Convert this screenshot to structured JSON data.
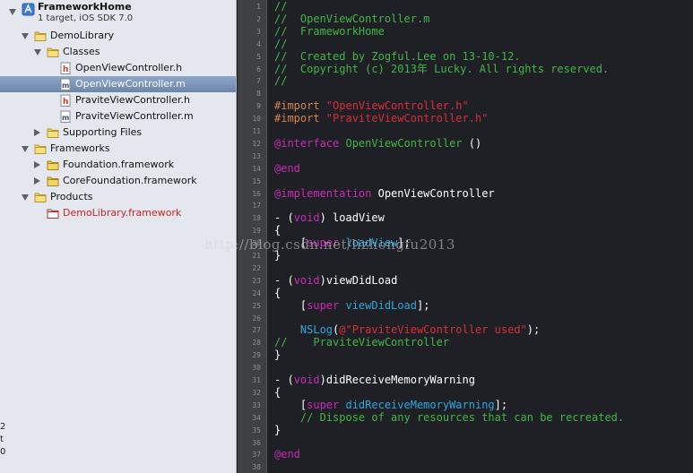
{
  "navigator": {
    "project_title": "FrameworkHome",
    "project_subtitle": "1 target, iOS SDK 7.0",
    "items": [
      {
        "label": "DemoLibrary",
        "icon": "folder-icon",
        "indent": 1,
        "disclosure": "open"
      },
      {
        "label": "Classes",
        "icon": "folder-icon",
        "indent": 2,
        "disclosure": "open"
      },
      {
        "label": "OpenViewController.h",
        "icon": "header-file-icon",
        "indent": 3,
        "disclosure": "none"
      },
      {
        "label": "OpenViewController.m",
        "icon": "implementation-file-icon",
        "indent": 3,
        "disclosure": "none",
        "selected": true
      },
      {
        "label": "PraviteViewController.h",
        "icon": "header-file-icon",
        "indent": 3,
        "disclosure": "none"
      },
      {
        "label": "PraviteViewController.m",
        "icon": "implementation-file-icon",
        "indent": 3,
        "disclosure": "none"
      },
      {
        "label": "Supporting Files",
        "icon": "folder-icon",
        "indent": 2,
        "disclosure": "closed"
      },
      {
        "label": "Frameworks",
        "icon": "folder-icon",
        "indent": 1,
        "disclosure": "open"
      },
      {
        "label": "Foundation.framework",
        "icon": "framework-icon",
        "indent": 2,
        "disclosure": "closed"
      },
      {
        "label": "CoreFoundation.framework",
        "icon": "framework-icon",
        "indent": 2,
        "disclosure": "closed"
      },
      {
        "label": "Products",
        "icon": "folder-icon",
        "indent": 1,
        "disclosure": "open"
      },
      {
        "label": "DemoLibrary.framework",
        "icon": "product-icon",
        "indent": 2,
        "disclosure": "none",
        "missing": true
      }
    ],
    "bottom_fragment": "2 t 0"
  },
  "colors": {
    "comment": "#41b645",
    "keyword": "#c72cb3",
    "string": "#db2c38",
    "preprocessor": "#d6824f",
    "class": "#78c2b3",
    "method": "#2ea6da",
    "plain": "#ffffff",
    "selection": "#6c86ad"
  },
  "editor": {
    "line_numbers": [
      "1",
      "2",
      "3",
      "4",
      "5",
      "6",
      "7",
      "8",
      "9",
      "10",
      "11",
      "12",
      "13",
      "14",
      "15",
      "16",
      "17",
      "18",
      "19",
      "20",
      "21",
      "22",
      "23",
      "24",
      "25",
      "26",
      "27",
      "28",
      "29",
      "30",
      "31",
      "32",
      "33",
      "34",
      "35",
      "36",
      "37",
      "38"
    ],
    "lines": [
      [
        {
          "t": "//",
          "c": "comment"
        }
      ],
      [
        {
          "t": "//  OpenViewController.m",
          "c": "comment"
        }
      ],
      [
        {
          "t": "//  FrameworkHome",
          "c": "comment"
        }
      ],
      [
        {
          "t": "//",
          "c": "comment"
        }
      ],
      [
        {
          "t": "//  Created by Zogful.Lee on 13-10-12.",
          "c": "comment"
        }
      ],
      [
        {
          "t": "//  Copyright (c) 2013年 Lucky. All rights reserved.",
          "c": "comment"
        }
      ],
      [
        {
          "t": "//",
          "c": "comment"
        }
      ],
      [],
      [
        {
          "t": "#import ",
          "c": "preprocessor"
        },
        {
          "t": "\"OpenViewController.h\"",
          "c": "string"
        }
      ],
      [
        {
          "t": "#import ",
          "c": "preprocessor"
        },
        {
          "t": "\"PraviteViewController.h\"",
          "c": "string"
        }
      ],
      [],
      [
        {
          "t": "@interface",
          "c": "keyword"
        },
        {
          "t": " ",
          "c": "plain"
        },
        {
          "t": "OpenViewController",
          "c": "comment"
        },
        {
          "t": " ()",
          "c": "plain"
        }
      ],
      [],
      [
        {
          "t": "@end",
          "c": "keyword"
        }
      ],
      [],
      [
        {
          "t": "@implementation",
          "c": "keyword"
        },
        {
          "t": " OpenViewController",
          "c": "plain"
        }
      ],
      [],
      [
        {
          "t": "- (",
          "c": "plain"
        },
        {
          "t": "void",
          "c": "keyword"
        },
        {
          "t": ") loadView",
          "c": "plain"
        }
      ],
      [
        {
          "t": "{",
          "c": "plain"
        }
      ],
      [
        {
          "t": "    [",
          "c": "plain"
        },
        {
          "t": "super",
          "c": "keyword"
        },
        {
          "t": " ",
          "c": "plain"
        },
        {
          "t": "loadView",
          "c": "method"
        },
        {
          "t": "];",
          "c": "plain"
        }
      ],
      [
        {
          "t": "}",
          "c": "plain"
        }
      ],
      [],
      [
        {
          "t": "- (",
          "c": "plain"
        },
        {
          "t": "void",
          "c": "keyword"
        },
        {
          "t": ")viewDidLoad",
          "c": "plain"
        }
      ],
      [
        {
          "t": "{",
          "c": "plain"
        }
      ],
      [
        {
          "t": "    [",
          "c": "plain"
        },
        {
          "t": "super",
          "c": "keyword"
        },
        {
          "t": " ",
          "c": "plain"
        },
        {
          "t": "viewDidLoad",
          "c": "method"
        },
        {
          "t": "];",
          "c": "plain"
        }
      ],
      [],
      [
        {
          "t": "    ",
          "c": "plain"
        },
        {
          "t": "NSLog",
          "c": "method"
        },
        {
          "t": "(",
          "c": "plain"
        },
        {
          "t": "@\"PraviteViewController used\"",
          "c": "string"
        },
        {
          "t": ");",
          "c": "plain"
        }
      ],
      [
        {
          "t": "//    PraviteViewController",
          "c": "comment"
        }
      ],
      [
        {
          "t": "}",
          "c": "plain"
        }
      ],
      [],
      [
        {
          "t": "- (",
          "c": "plain"
        },
        {
          "t": "void",
          "c": "keyword"
        },
        {
          "t": ")didReceiveMemoryWarning",
          "c": "plain"
        }
      ],
      [
        {
          "t": "{",
          "c": "plain"
        }
      ],
      [
        {
          "t": "    [",
          "c": "plain"
        },
        {
          "t": "super",
          "c": "keyword"
        },
        {
          "t": " ",
          "c": "plain"
        },
        {
          "t": "didReceiveMemoryWarning",
          "c": "method"
        },
        {
          "t": "];",
          "c": "plain"
        }
      ],
      [
        {
          "t": "    // Dispose of any resources that can be recreated.",
          "c": "comment"
        }
      ],
      [
        {
          "t": "}",
          "c": "plain"
        }
      ],
      [],
      [
        {
          "t": "@end",
          "c": "keyword"
        }
      ],
      []
    ]
  },
  "watermark": "http://blog.csdn.net/lizhongfu2013"
}
